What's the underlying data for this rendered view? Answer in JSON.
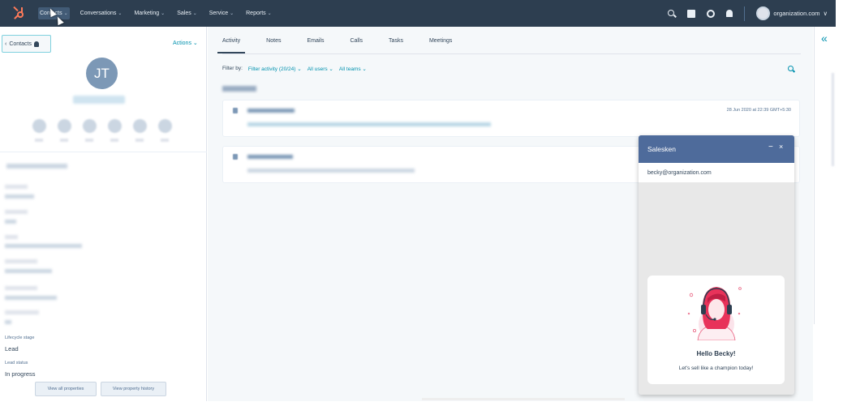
{
  "topnav": {
    "items": [
      {
        "label": "Contacts",
        "active": true
      },
      {
        "label": "Conversations",
        "active": false
      },
      {
        "label": "Marketing",
        "active": false
      },
      {
        "label": "Sales",
        "active": false
      },
      {
        "label": "Service",
        "active": false
      },
      {
        "label": "Reports",
        "active": false
      }
    ],
    "caret": "⌄",
    "account": "organization.com",
    "account_caret": "∨",
    "icons": [
      "search-icon",
      "marketplace-icon",
      "settings-gear-icon",
      "notifications-bell-icon"
    ]
  },
  "sidebar": {
    "back_label": "Contacts",
    "actions_label": "Actions ⌄",
    "avatar_initials": "JT",
    "lifecycle_label": "Lifecycle stage",
    "lifecycle_value": "Lead",
    "lead_status_label": "Lead status",
    "lead_status_value": "In progress",
    "view_all_label": "View all properties",
    "view_history_label": "View property history"
  },
  "main": {
    "tabs": [
      "Activity",
      "Notes",
      "Emails",
      "Calls",
      "Tasks",
      "Meetings"
    ],
    "active_tab": "Activity",
    "filter_by": "Filter by:",
    "filter_activity": "Filter activity (20/24) ⌄",
    "all_users": "All users ⌄",
    "all_teams": "All teams ⌄",
    "timestamp": "28 Jun 2020 at 22:39 GMT+5:30"
  },
  "right_strip": {
    "collapse_icon": "«"
  },
  "salesken": {
    "title": "Salesken",
    "minimize": "−",
    "close": "×",
    "email": "becky@organization.com",
    "hello": "Hello Becky!",
    "subtitle": "Let's sell like a champion today!"
  },
  "colors": {
    "nav_bg": "#2d3e50",
    "accent_link": "#0091ae",
    "avatar_bg": "#7c98b6",
    "salesken_header": "#4e6b9b",
    "hubspot_orange": "#ff7a59"
  }
}
